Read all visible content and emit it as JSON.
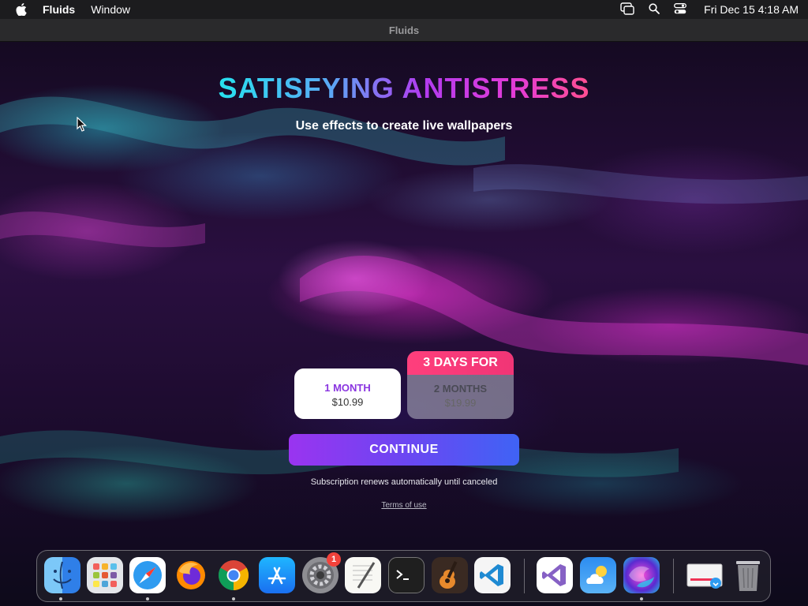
{
  "menubar": {
    "app_name": "Fluids",
    "menu_items": [
      "Window"
    ],
    "clock": "Fri Dec 15  4:18 AM"
  },
  "window": {
    "title": "Fluids"
  },
  "paywall": {
    "headline": "SATISFYING ANTISTRESS",
    "subtitle": "Use effects to create live wallpapers",
    "plans": [
      {
        "name": "1 MONTH",
        "price": "$10.99",
        "selected": true
      },
      {
        "banner": "3 DAYS FOR",
        "name": "2 MONTHS",
        "price": "$19.99",
        "selected": false
      }
    ],
    "continue_label": "CONTINUE",
    "renew_note": "Subscription renews automatically until canceled",
    "terms_label": "Terms of use"
  },
  "dock": {
    "apps": [
      {
        "name": "Finder",
        "icon": "finder-icon",
        "running": true
      },
      {
        "name": "Launchpad",
        "icon": "launchpad-icon",
        "running": false
      },
      {
        "name": "Safari",
        "icon": "safari-icon",
        "running": true
      },
      {
        "name": "Firefox",
        "icon": "firefox-icon",
        "running": false
      },
      {
        "name": "Google Chrome",
        "icon": "chrome-icon",
        "running": true
      },
      {
        "name": "App Store",
        "icon": "app-store-icon",
        "running": false
      },
      {
        "name": "System Settings",
        "icon": "system-settings-icon",
        "running": false,
        "badge": "1"
      },
      {
        "name": "TextEdit",
        "icon": "textedit-icon",
        "running": false
      },
      {
        "name": "Terminal",
        "icon": "terminal-icon",
        "running": false
      },
      {
        "name": "GarageBand",
        "icon": "garageband-icon",
        "running": false
      },
      {
        "name": "Visual Studio Code",
        "icon": "vscode-icon",
        "running": false
      },
      {
        "name": "Visual Studio",
        "icon": "visual-studio-icon",
        "running": false
      },
      {
        "name": "Weather",
        "icon": "weather-icon",
        "running": false
      },
      {
        "name": "Fluids",
        "icon": "fluids-icon",
        "running": true
      },
      {
        "name": "Downloads",
        "icon": "downloads-stack-icon",
        "running": false
      },
      {
        "name": "Trash",
        "icon": "trash-icon",
        "running": false
      }
    ]
  },
  "colors": {
    "accent_purple": "#8a35e0",
    "continue_gradient": [
      "#9a34f0",
      "#3f63f5"
    ],
    "banner_pink": "#ff3f7c",
    "badge_red": "#f2423b"
  }
}
